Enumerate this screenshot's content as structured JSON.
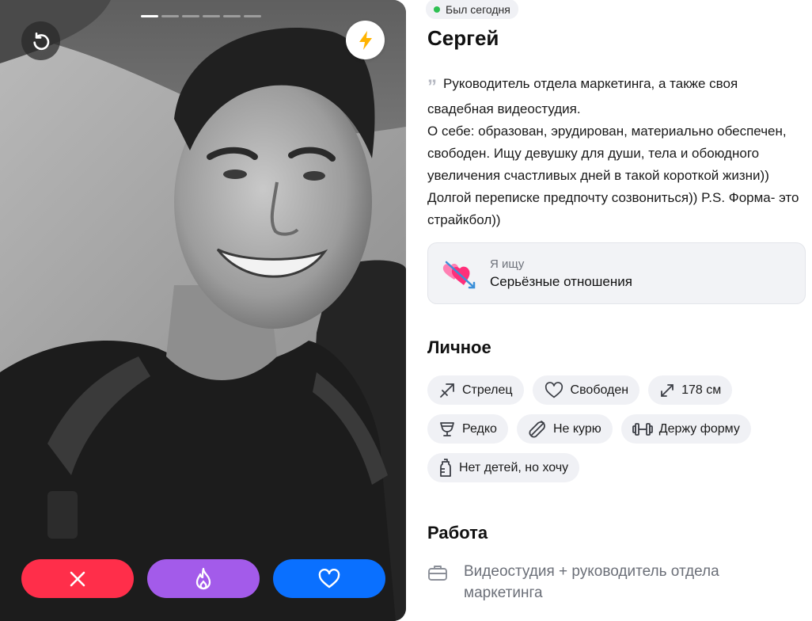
{
  "photo": {
    "pager_total": 6,
    "pager_current": 1
  },
  "controls": {
    "undo_icon": "undo-icon",
    "boost_icon": "lightning-icon",
    "dislike_icon": "close-icon",
    "superlike_icon": "flame-icon",
    "like_icon": "heart-icon"
  },
  "colors": {
    "dislike": "#ff2e4a",
    "superlike": "#a35bea",
    "like": "#0a70ff",
    "online": "#2ec052",
    "boost": "#ffb300"
  },
  "profile": {
    "status": "Был сегодня",
    "name": "Сергей",
    "bio": [
      "Руководитель отдела маркетинга, а также своя свадебная видеостудия.",
      "О себе: образован, эрудирован, материально обеспечен, свободен. Ищу девушку для души, тела и обоюдного увеличения счастливых дней в такой короткой жизни)) Долгой переписке предпочту созвониться)) P.S. Форма- это страйкбол))"
    ],
    "looking_for": {
      "label": "Я ищу",
      "value": "Серьёзные отношения",
      "icon": "hearts-arrow-icon"
    }
  },
  "personal": {
    "title": "Личное",
    "chips": [
      {
        "icon": "sagittarius-icon",
        "label": "Стрелец"
      },
      {
        "icon": "heart-outline-icon",
        "label": "Свободен"
      },
      {
        "icon": "height-icon",
        "label": "178 см"
      },
      {
        "icon": "glass-icon",
        "label": "Редко"
      },
      {
        "icon": "no-smoking-icon",
        "label": "Не курю"
      },
      {
        "icon": "dumbbell-icon",
        "label": "Держу форму"
      },
      {
        "icon": "baby-bottle-icon",
        "label": "Нет детей, но хочу"
      }
    ]
  },
  "work": {
    "title": "Работа",
    "icon": "briefcase-icon",
    "text": "Видеостудия + руководитель отдела маркетинга"
  }
}
